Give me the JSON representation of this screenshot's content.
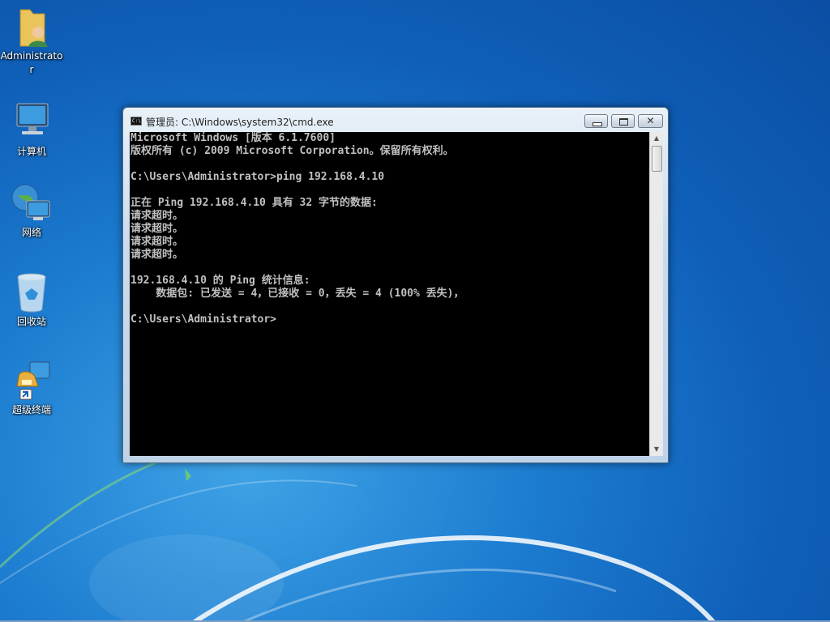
{
  "desktop": {
    "icons": [
      {
        "label": "Administrator",
        "icon": "user-folder-icon"
      },
      {
        "label": "计算机",
        "icon": "computer-icon"
      },
      {
        "label": "网络",
        "icon": "network-icon"
      },
      {
        "label": "回收站",
        "icon": "recycle-bin-icon"
      },
      {
        "label": "超级终端",
        "icon": "hyperterminal-shortcut-icon"
      }
    ]
  },
  "cmd_window": {
    "title": "管理员: C:\\Windows\\system32\\cmd.exe",
    "icon_text": "C:\\",
    "buttons": {
      "minimize": "minimize",
      "maximize": "maximize",
      "close": "✕"
    },
    "lines": [
      "Microsoft Windows [版本 6.1.7600]",
      "版权所有 (c) 2009 Microsoft Corporation。保留所有权利。",
      "",
      "C:\\Users\\Administrator>ping 192.168.4.10",
      "",
      "正在 Ping 192.168.4.10 具有 32 字节的数据:",
      "请求超时。",
      "请求超时。",
      "请求超时。",
      "请求超时。",
      "",
      "192.168.4.10 的 Ping 统计信息:",
      "    数据包: 已发送 = 4，已接收 = 0，丢失 = 4 (100% 丢失)，",
      "",
      "C:\\Users\\Administrator>"
    ]
  },
  "colors": {
    "console_bg": "#000000",
    "console_fg": "#c0c0c0",
    "desktop_accent": "#1c7cd0"
  }
}
